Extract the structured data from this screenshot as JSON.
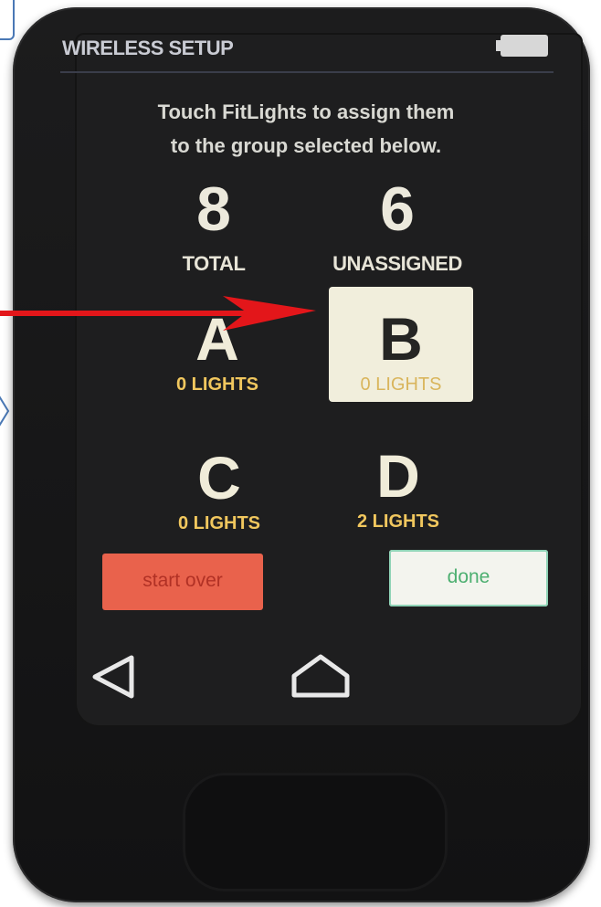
{
  "header": {
    "title": "WIRELESS SETUP"
  },
  "instructions": {
    "line1": "Touch FitLights to assign them",
    "line2": "to the group selected below."
  },
  "counts": {
    "total": {
      "value": "8",
      "label": "TOTAL"
    },
    "unassigned": {
      "value": "6",
      "label": "UNASSIGNED"
    }
  },
  "groups": [
    {
      "letter": "A",
      "lights": "0 LIGHTS",
      "selected": false
    },
    {
      "letter": "B",
      "lights": "0 LIGHTS",
      "selected": true
    },
    {
      "letter": "C",
      "lights": "0 LIGHTS",
      "selected": false
    },
    {
      "letter": "D",
      "lights": "2 LIGHTS",
      "selected": false
    }
  ],
  "buttons": {
    "start_over": "start over",
    "done": "done"
  },
  "nav": {
    "back_icon": "back-triangle-icon",
    "home_icon": "home-icon"
  },
  "colors": {
    "accent_yellow": "#f1c75e",
    "start_over_bg": "#e9624c",
    "done_text": "#4caf70",
    "annotation_arrow": "#e3161a"
  }
}
